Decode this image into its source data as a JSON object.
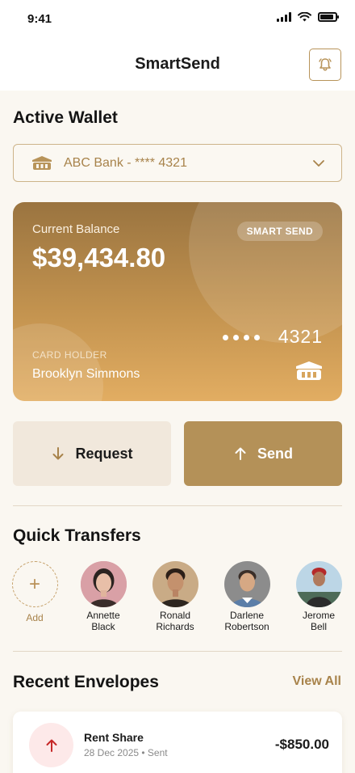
{
  "status_bar": {
    "time": "9:41"
  },
  "header": {
    "title": "SmartSend",
    "bell_icon": "bell-icon"
  },
  "wallet": {
    "section_title": "Active Wallet",
    "selected": "ABC Bank - **** 4321",
    "icon": "bank-icon"
  },
  "card": {
    "balance_label": "Current Balance",
    "balance": "$39,434.80",
    "badge": "SMART SEND",
    "dots": "••••",
    "last4": "4321",
    "holder_label": "CARD HOLDER",
    "holder_name": "Brooklyn Simmons"
  },
  "actions": {
    "request_label": "Request",
    "send_label": "Send"
  },
  "quick_transfers": {
    "section_title": "Quick Transfers",
    "add_label": "Add",
    "contacts": [
      {
        "first": "Annette",
        "last": "Black"
      },
      {
        "first": "Ronald",
        "last": "Richards"
      },
      {
        "first": "Darlene",
        "last": "Robertson"
      },
      {
        "first": "Jerome",
        "last": "Bell"
      }
    ]
  },
  "recent_envelopes": {
    "section_title": "Recent Envelopes",
    "view_all": "View All",
    "items": [
      {
        "title": "Rent Share",
        "meta": "28 Dec 2025 • Sent",
        "amount": "-$850.00"
      }
    ]
  },
  "colors": {
    "accent": "#b49158",
    "accent_text": "#a8834b",
    "background": "#faf7f1",
    "sent_icon": "#c62828"
  }
}
